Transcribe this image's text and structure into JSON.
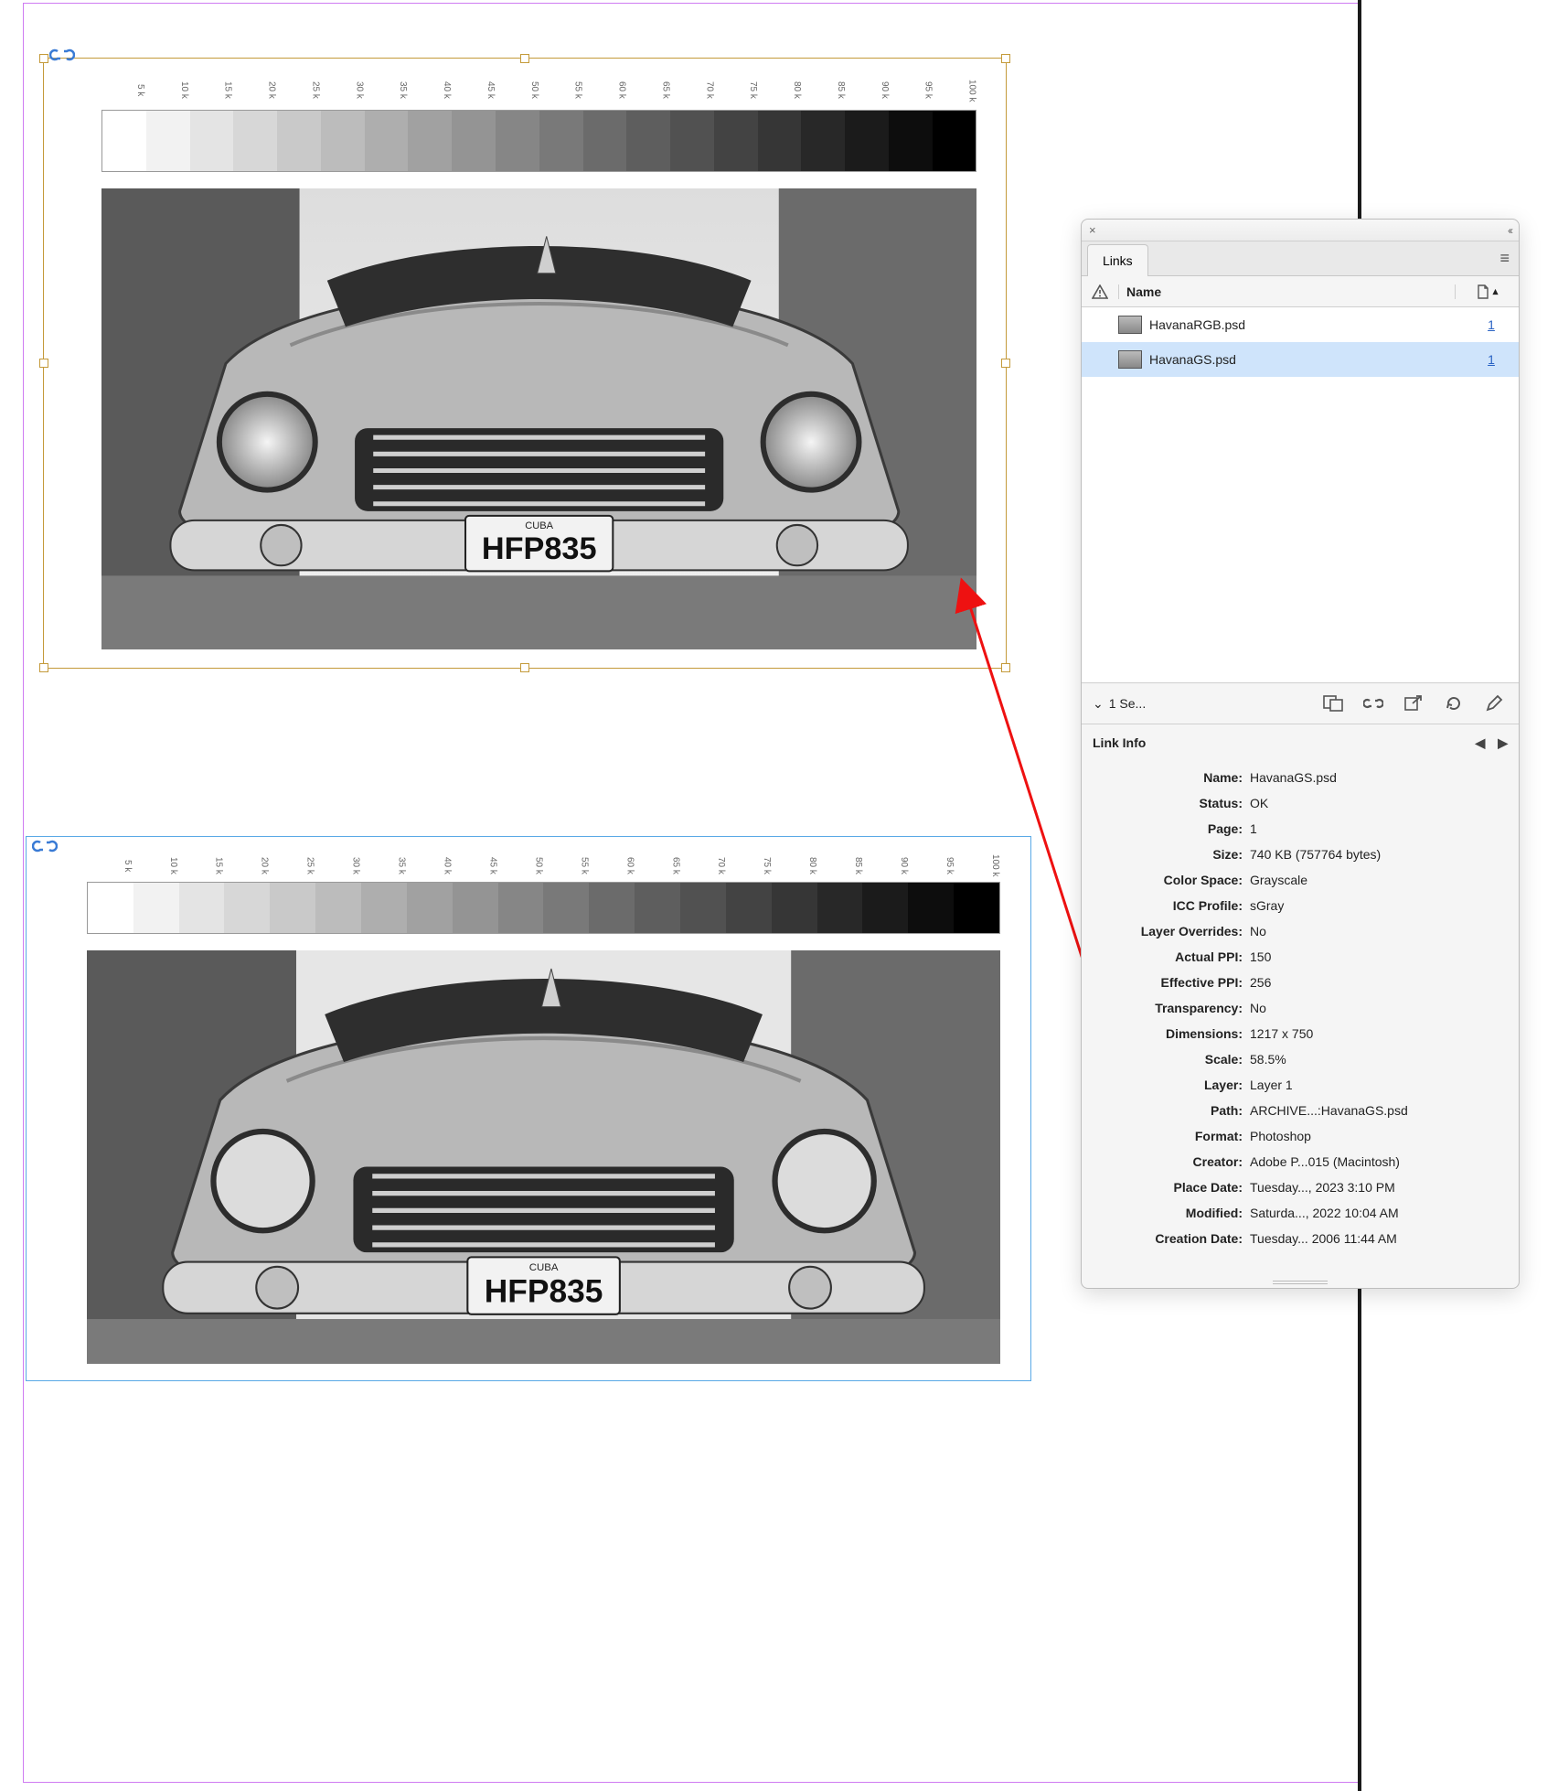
{
  "gradient": {
    "labels": [
      "5 k",
      "10 k",
      "15 k",
      "20 k",
      "25 k",
      "30 k",
      "35 k",
      "40 k",
      "45 k",
      "50 k",
      "55 k",
      "60 k",
      "65 k",
      "70 k",
      "75 k",
      "80 k",
      "85 k",
      "90 k",
      "95 k",
      "100 k"
    ]
  },
  "car": {
    "plate_country": "CUBA",
    "plate_number": "HFP835"
  },
  "panel": {
    "title": "Links",
    "header": {
      "name_label": "Name"
    },
    "rows": [
      {
        "name": "HavanaRGB.psd",
        "page": "1",
        "selected": false
      },
      {
        "name": "HavanaGS.psd",
        "page": "1",
        "selected": true
      }
    ],
    "selection_text": "1 Se...",
    "info_title": "Link Info",
    "info": [
      {
        "k": "Name:",
        "v": "HavanaGS.psd"
      },
      {
        "k": "Status:",
        "v": "OK"
      },
      {
        "k": "Page:",
        "v": "1"
      },
      {
        "k": "Size:",
        "v": "740 KB (757764 bytes)"
      },
      {
        "k": "Color Space:",
        "v": "Grayscale"
      },
      {
        "k": "ICC Profile:",
        "v": "sGray"
      },
      {
        "k": "Layer Overrides:",
        "v": "No"
      },
      {
        "k": "Actual PPI:",
        "v": "150"
      },
      {
        "k": "Effective PPI:",
        "v": "256"
      },
      {
        "k": "Transparency:",
        "v": "No"
      },
      {
        "k": "Dimensions:",
        "v": "1217 x 750"
      },
      {
        "k": "Scale:",
        "v": "58.5%"
      },
      {
        "k": "Layer:",
        "v": "Layer 1"
      },
      {
        "k": "Path:",
        "v": "ARCHIVE...:HavanaGS.psd"
      },
      {
        "k": "Format:",
        "v": "Photoshop"
      },
      {
        "k": "Creator:",
        "v": "Adobe P...015 (Macintosh)"
      },
      {
        "k": "Place Date:",
        "v": "Tuesday..., 2023 3:10 PM"
      },
      {
        "k": "Modified:",
        "v": "Saturda..., 2022 10:04 AM"
      },
      {
        "k": "Creation Date:",
        "v": "Tuesday... 2006 11:44 AM"
      }
    ]
  }
}
